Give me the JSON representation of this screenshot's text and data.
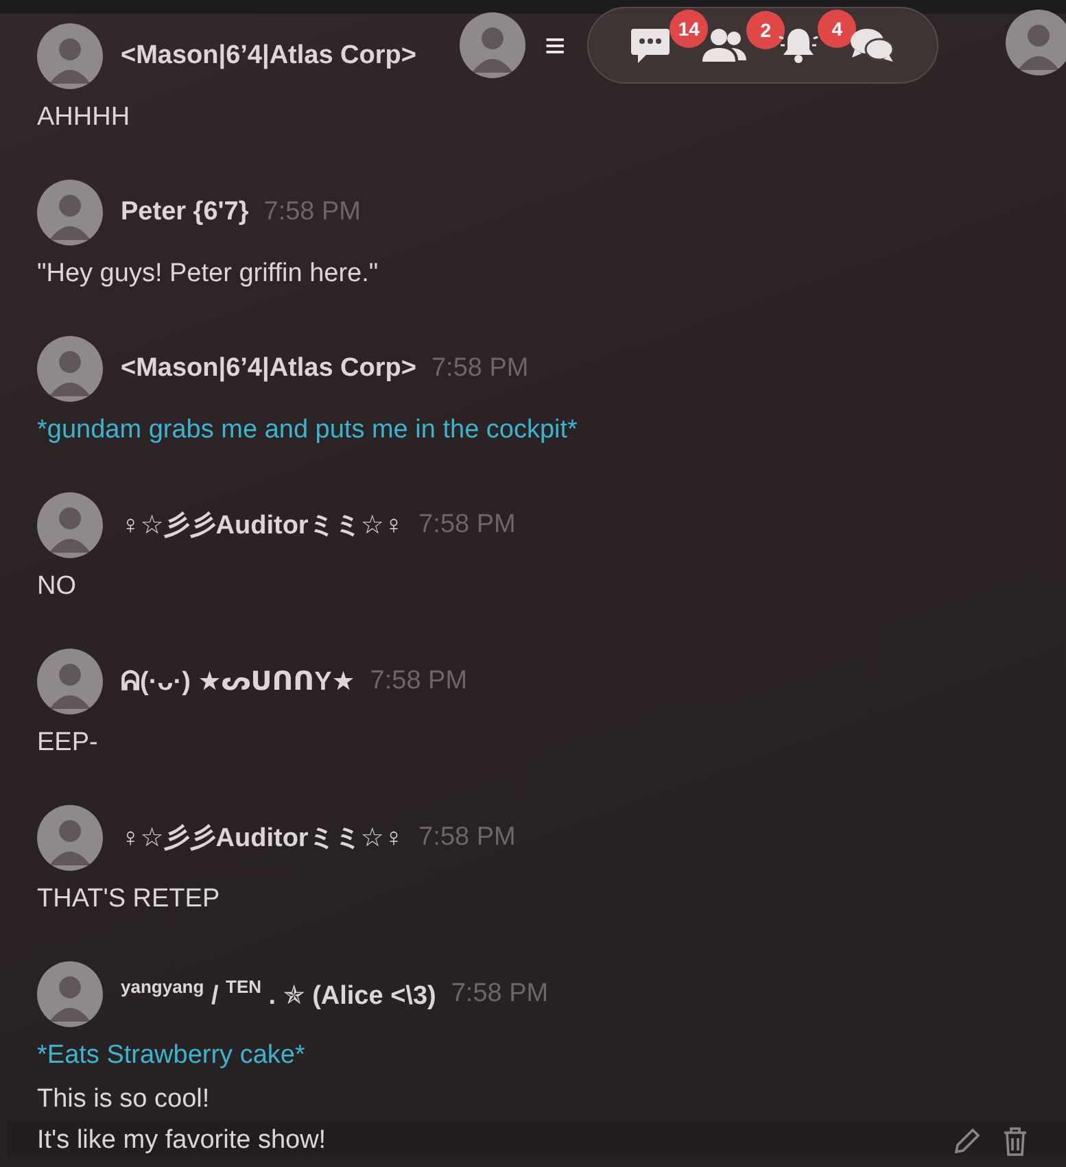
{
  "toolbar": {
    "menu_icon": "≡",
    "badges": [
      {
        "kind": "chat",
        "count": "14"
      },
      {
        "kind": "friends",
        "count": "2"
      },
      {
        "kind": "bell",
        "count": "4"
      },
      {
        "kind": "threads"
      }
    ]
  },
  "messages": [
    {
      "author": "<Mason|6’4|Atlas Corp>",
      "lines": [
        {
          "kind": "text",
          "text": "AHHHH"
        }
      ]
    },
    {
      "author": "Peter {6'7}",
      "time": "7:58 PM",
      "lines": [
        {
          "kind": "text",
          "text": "\"Hey guys! Peter griffin here.\""
        }
      ]
    },
    {
      "author": "<Mason|6’4|Atlas Corp>",
      "time": "7:58 PM",
      "lines": [
        {
          "kind": "action",
          "text": "*gundam grabs me and puts me in the cockpit*"
        }
      ]
    },
    {
      "author": "♀☆彡彡Auditorミミ☆♀",
      "time": "7:58 PM",
      "lines": [
        {
          "kind": "text",
          "text": "NO"
        }
      ]
    },
    {
      "author": "ᕱ(·ᴗ·) ★ᔕᑌᑎᑎY★",
      "time": "7:58 PM",
      "lines": [
        {
          "kind": "text",
          "text": "EEP-"
        }
      ]
    },
    {
      "author": "♀☆彡彡Auditorミミ☆♀",
      "time": "7:58 PM",
      "lines": [
        {
          "kind": "text",
          "text": "THAT'S RETEP"
        }
      ]
    },
    {
      "author": "$^{yangyang}$ / $^{TEN}$ . ✯ (Alice <\\3)",
      "time": "7:58 PM",
      "lines": [
        {
          "kind": "action",
          "text": "*Eats Strawberry cake*"
        },
        {
          "kind": "text",
          "text": "This is so cool!"
        },
        {
          "kind": "text",
          "text": "It's like my favorite show!",
          "hovered": true
        }
      ]
    }
  ]
}
